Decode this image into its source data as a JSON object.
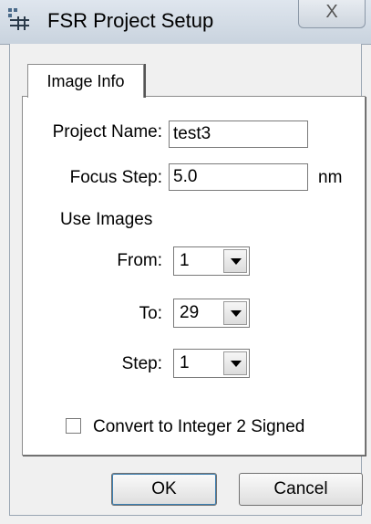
{
  "window": {
    "title": "FSR Project Setup",
    "close_symbol": "X",
    "icon": "fsr-app-icon"
  },
  "tabs": [
    {
      "label": "Image Info",
      "selected": true
    }
  ],
  "form": {
    "project_name": {
      "label": "Project Name:",
      "value": "test3"
    },
    "focus_step": {
      "label": "Focus Step:",
      "value": "5.0",
      "unit": "nm"
    },
    "use_images_label": "Use Images",
    "from": {
      "label": "From:",
      "value": "1"
    },
    "to": {
      "label": "To:",
      "value": "29"
    },
    "step": {
      "label": "Step:",
      "value": "1"
    },
    "convert_checkbox": {
      "label": "Convert to Integer 2 Signed",
      "checked": false
    }
  },
  "buttons": {
    "ok": "OK",
    "cancel": "Cancel"
  },
  "colors": {
    "titlebar": "#c9d3de",
    "dialog_bg": "#f0f0f0",
    "panel_bg": "#ffffff"
  }
}
